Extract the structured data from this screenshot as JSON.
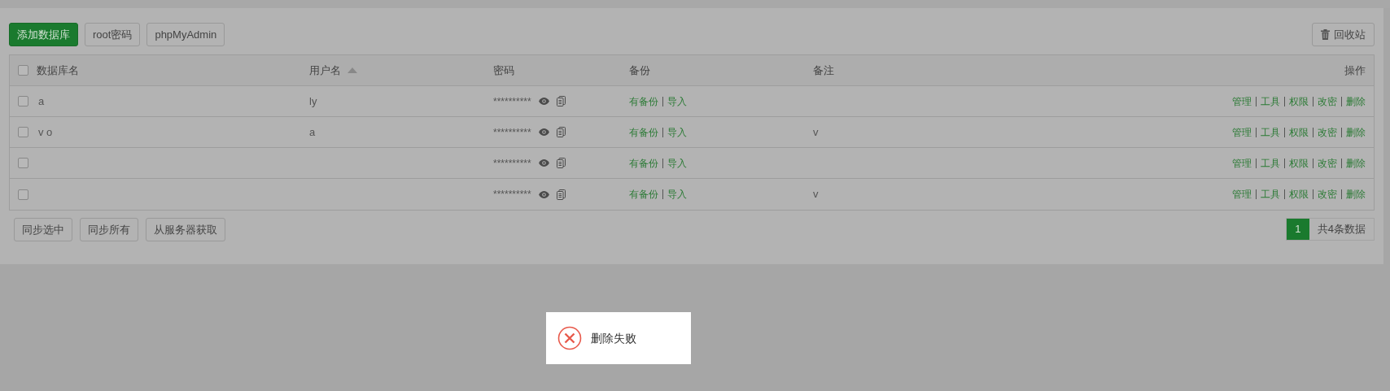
{
  "toolbar": {
    "buttons": [
      {
        "label": "添加数据库",
        "kind": "primary"
      },
      {
        "label": "root密码",
        "kind": "default"
      },
      {
        "label": "phpMyAdmin",
        "kind": "default"
      }
    ],
    "recycle_button": "回收站"
  },
  "table": {
    "select_all_checked": false,
    "columns": [
      {
        "label": "数据库名",
        "sorted": false
      },
      {
        "label": "用户名",
        "sorted": true
      },
      {
        "label": "密码",
        "sorted": false
      },
      {
        "label": "备份",
        "sorted": false
      },
      {
        "label": "备注",
        "sorted": false
      },
      {
        "label": "操作",
        "sorted": false
      }
    ],
    "rows": [
      {
        "checked": false,
        "name": "a",
        "user": "ly",
        "password": "**********",
        "backup": "有备份",
        "import": "导入",
        "actions": [
          "管理",
          "工具",
          "权限",
          "改密",
          "删除"
        ]
      },
      {
        "checked": false,
        "name": "v o",
        "user": "a",
        "password": "**********",
        "backup": "有备份",
        "import": "导入",
        "remark": "v",
        "actions": [
          "管理",
          "工具",
          "权限",
          "改密",
          "删除"
        ]
      },
      {
        "checked": false,
        "password": "**********",
        "backup": "有备份",
        "import": "导入",
        "actions": [
          "管理",
          "工具",
          "权限",
          "改密",
          "删除"
        ]
      },
      {
        "checked": false,
        "password": "**********",
        "backup": "有备份",
        "import": "导入",
        "remark": "v",
        "actions": [
          "管理",
          "工具",
          "权限",
          "改密",
          "删除"
        ]
      }
    ]
  },
  "bottom_buttons": [
    "同步选中",
    "同步所有",
    "从服务器获取"
  ],
  "pagination": {
    "pages": [
      {
        "label": "1",
        "selected": true
      }
    ],
    "total": "共4条数据"
  },
  "toast": {
    "kind": "error",
    "message": "删除失败"
  }
}
